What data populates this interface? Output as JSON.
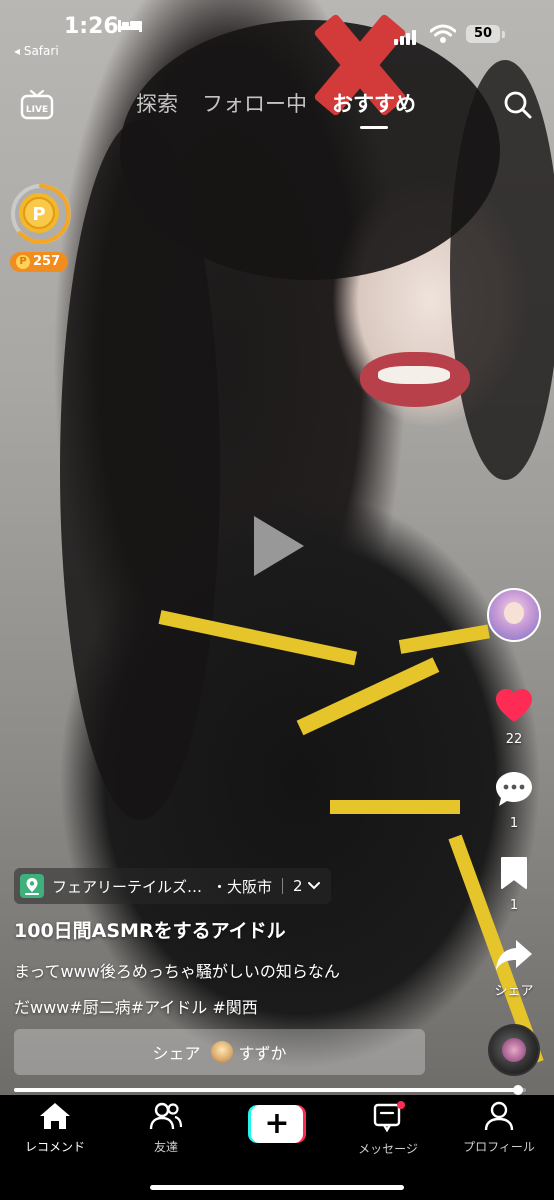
{
  "status_bar": {
    "time": "1:26",
    "back_label": "◂ Safari",
    "battery": "50"
  },
  "top_nav": {
    "live_label": "LIVE",
    "tabs": [
      {
        "label": "探索",
        "active": false
      },
      {
        "label": "フォロー中",
        "active": false
      },
      {
        "label": "おすすめ",
        "active": true
      }
    ]
  },
  "coin": {
    "symbol": "P",
    "badge_symbol": "P",
    "points": "257"
  },
  "actions": {
    "like_count": "22",
    "comment_count": "1",
    "bookmark_count": "1",
    "share_label": "シェア"
  },
  "location": {
    "place": "フェアリーテイルズ…",
    "city": "・大阪市",
    "count": "2"
  },
  "caption": {
    "title": "100日間ASMRをするアイドル",
    "line1": "まってwww後ろめっちゃ騒がしいの知らなん",
    "line2": "だwww#厨二病#アイドル #関西"
  },
  "share_bar": {
    "label": "シェア",
    "user": "すずか"
  },
  "progress": {
    "fraction": 0.985
  },
  "bottom_nav": {
    "items": [
      {
        "label": "レコメンド",
        "icon": "home-icon"
      },
      {
        "label": "友達",
        "icon": "friends-icon"
      },
      {
        "label": "+",
        "icon": "create-icon"
      },
      {
        "label": "メッセージ",
        "icon": "inbox-icon"
      },
      {
        "label": "プロフィール",
        "icon": "profile-icon"
      }
    ]
  },
  "colors": {
    "like": "#fe2c55",
    "coin": "#f5a623",
    "location_icon": "#3fb07c",
    "notification_dot": "#fe2c55"
  }
}
